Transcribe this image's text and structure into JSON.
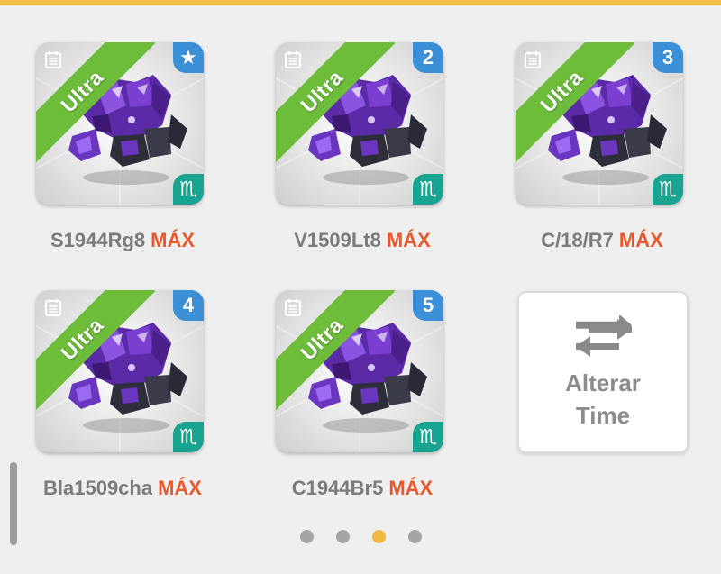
{
  "monsters": [
    {
      "name": "S1944Rg8",
      "level_tag": "MÁX",
      "rarity": "Ultra",
      "badge": "★",
      "badge_icon": "star-icon",
      "element": "♏"
    },
    {
      "name": "V1509Lt8",
      "level_tag": "MÁX",
      "rarity": "Ultra",
      "badge": "2",
      "element": "♏"
    },
    {
      "name": "C/18/R7",
      "level_tag": "MÁX",
      "rarity": "Ultra",
      "badge": "3",
      "element": "♏"
    },
    {
      "name": "Bla1509cha",
      "level_tag": "MÁX",
      "rarity": "Ultra",
      "badge": "4",
      "element": "♏"
    },
    {
      "name": "C1944Br5",
      "level_tag": "MÁX",
      "rarity": "Ultra",
      "badge": "5",
      "element": "♏"
    }
  ],
  "change_team": {
    "line1": "Alterar",
    "line2": "Time",
    "icon": "swap-arrows-icon"
  },
  "pagination": {
    "total": 4,
    "active": 3
  },
  "colors": {
    "accent": "#f1c04a",
    "rarity_ultra": "#6dbd3b",
    "badge_blue": "#3b8fd6",
    "element_teal": "#19a391",
    "max_orange": "#e8582a"
  }
}
